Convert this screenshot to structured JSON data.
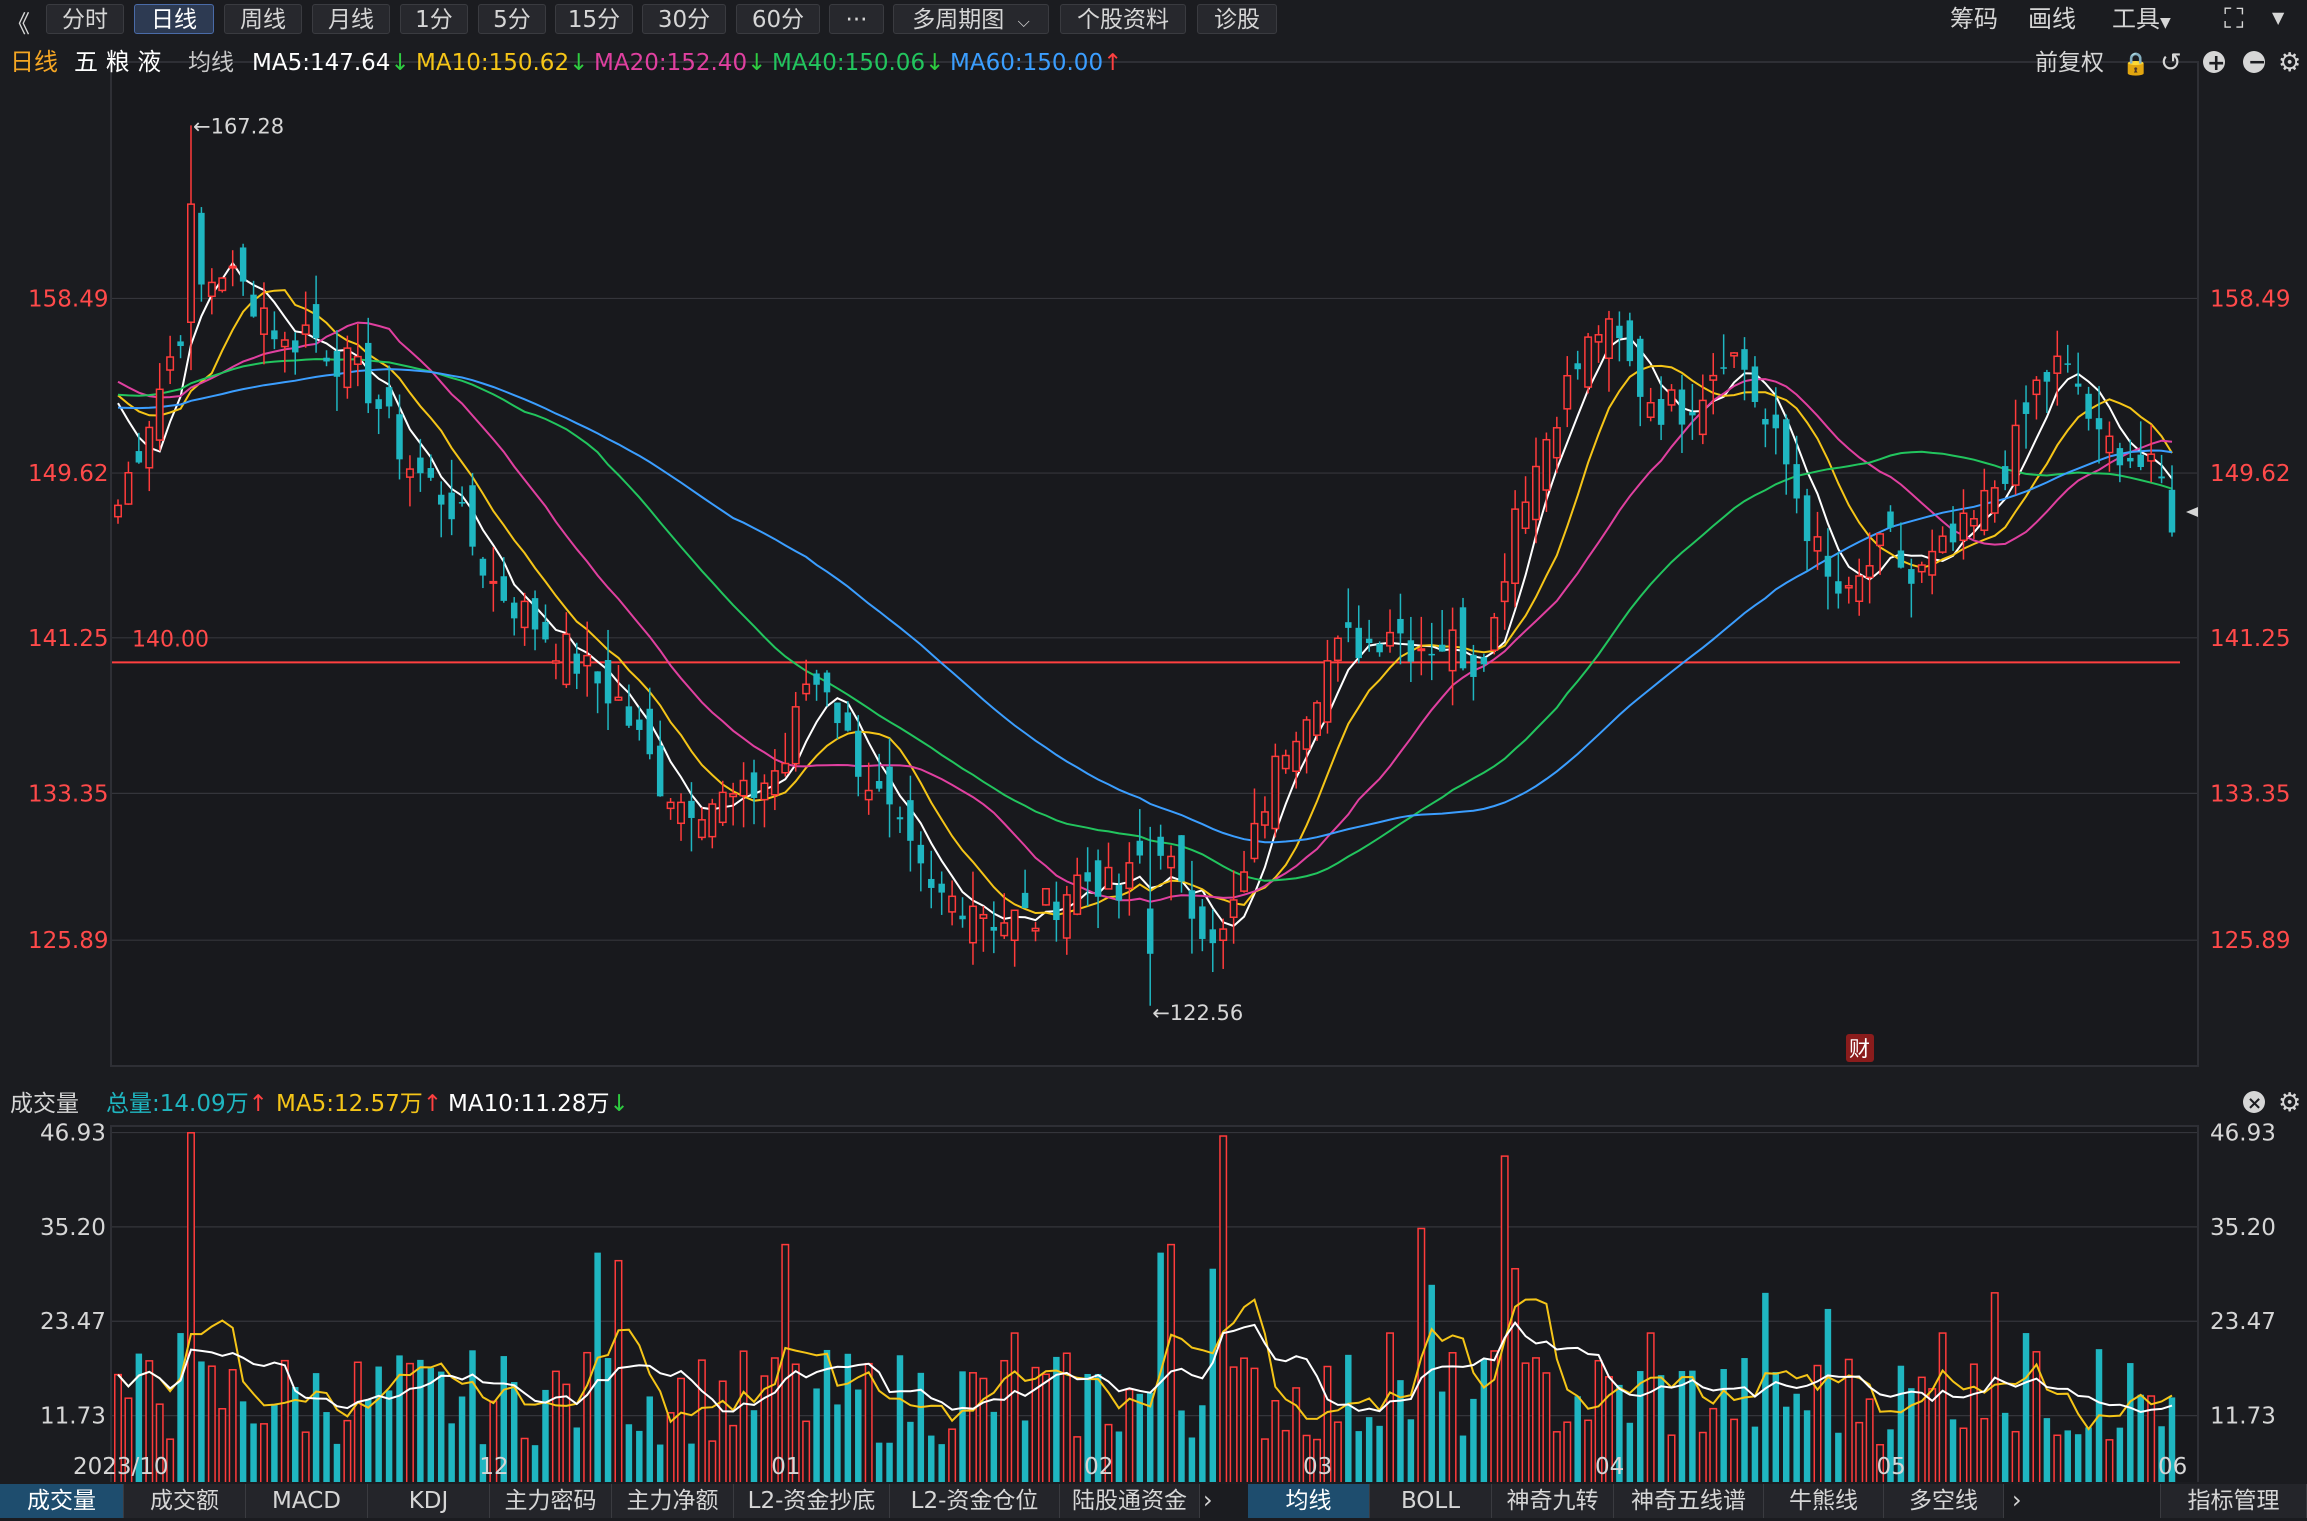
{
  "toolbar": {
    "back": "《",
    "tabs": [
      "分时",
      "日线",
      "周线",
      "月线",
      "1分",
      "5分",
      "15分",
      "30分",
      "60分"
    ],
    "active_tab": 1,
    "more": "···",
    "multi": "多周期图",
    "profile": "个股资料",
    "diag": "诊股",
    "right": [
      "筹码",
      "画线",
      "工具"
    ]
  },
  "header": {
    "period": "日线",
    "stock": "五 粮 液",
    "ma_label": "均线",
    "ma": [
      {
        "text": "MA5:147.64",
        "arrow": "↓",
        "color": "#ffffff",
        "arrow_color": "#2ecc40"
      },
      {
        "text": "MA10:150.62",
        "arrow": "↓",
        "color": "#f5c518",
        "arrow_color": "#2ecc40"
      },
      {
        "text": "MA20:152.40",
        "arrow": "↓",
        "color": "#e040a0",
        "arrow_color": "#2ecc40"
      },
      {
        "text": "MA40:150.06",
        "arrow": "↓",
        "color": "#22c55e",
        "arrow_color": "#2ecc40"
      },
      {
        "text": "MA60:150.00",
        "arrow": "↑",
        "color": "#3b9eff",
        "arrow_color": "#ff4040"
      }
    ],
    "adjust": "前复权"
  },
  "volume_header": {
    "title": "成交量",
    "total": "总量:14.09万",
    "total_arrow": "↑",
    "ma5": "MA5:12.57万",
    "ma5_arrow": "↑",
    "ma10": "MA10:11.28万",
    "ma10_arrow": "↓"
  },
  "bottom_tabs_left": [
    "成交量",
    "成交额",
    "MACD",
    "KDJ",
    "主力密码",
    "主力净额",
    "L2-资金抄底",
    "L2-资金仓位",
    "陆股通资金"
  ],
  "bottom_tabs_right": [
    "均线",
    "BOLL",
    "神奇九转",
    "神奇五线谱",
    "牛熊线",
    "多空线"
  ],
  "bottom_right": "指标管理",
  "chart_data": {
    "type": "candlestick",
    "price_axis_labels": [
      "158.49",
      "149.62",
      "141.25",
      "133.35",
      "125.89"
    ],
    "price_ticks": [
      158.49,
      149.62,
      141.25,
      133.35,
      125.89
    ],
    "price_range": [
      119.5,
      170.5
    ],
    "high_annotation": "←167.28",
    "high_value": 167.28,
    "low_annotation": "←122.56",
    "low_value": 122.56,
    "hline_label": "140.00",
    "hline_value": 140.0,
    "badge": "财",
    "volume_axis_labels": [
      "46.93",
      "35.20",
      "23.47",
      "11.73"
    ],
    "volume_ticks": [
      46.93,
      35.2,
      23.47,
      11.73
    ],
    "volume_unit": "万",
    "volume_range": [
      0,
      47
    ],
    "x_labels": [
      {
        "label": "2023/10",
        "index": 0
      },
      {
        "label": "12",
        "index": 36
      },
      {
        "label": "01",
        "index": 64
      },
      {
        "label": "02",
        "index": 94
      },
      {
        "label": "03",
        "index": 115
      },
      {
        "label": "04",
        "index": 143
      },
      {
        "label": "05",
        "index": 170
      },
      {
        "label": "06",
        "index": 197
      }
    ],
    "count": 198,
    "waypoints": [
      [
        0,
        148
      ],
      [
        2,
        151
      ],
      [
        4,
        154
      ],
      [
        6,
        157
      ],
      [
        7,
        163
      ],
      [
        8,
        159
      ],
      [
        10,
        160
      ],
      [
        12,
        159
      ],
      [
        14,
        158
      ],
      [
        16,
        156
      ],
      [
        18,
        157
      ],
      [
        20,
        156
      ],
      [
        22,
        155
      ],
      [
        24,
        154
      ],
      [
        26,
        152
      ],
      [
        28,
        150
      ],
      [
        30,
        149
      ],
      [
        32,
        148
      ],
      [
        34,
        146
      ],
      [
        36,
        144
      ],
      [
        38,
        143
      ],
      [
        40,
        142
      ],
      [
        42,
        141
      ],
      [
        44,
        140
      ],
      [
        46,
        139
      ],
      [
        48,
        138
      ],
      [
        50,
        136
      ],
      [
        52,
        134
      ],
      [
        54,
        133
      ],
      [
        56,
        133
      ],
      [
        58,
        133
      ],
      [
        60,
        133
      ],
      [
        62,
        134
      ],
      [
        64,
        135
      ],
      [
        66,
        139
      ],
      [
        68,
        139
      ],
      [
        70,
        136
      ],
      [
        72,
        134
      ],
      [
        74,
        132
      ],
      [
        76,
        130
      ],
      [
        78,
        128
      ],
      [
        80,
        128
      ],
      [
        82,
        128
      ],
      [
        84,
        127
      ],
      [
        86,
        127
      ],
      [
        88,
        127
      ],
      [
        90,
        128
      ],
      [
        92,
        129
      ],
      [
        94,
        129
      ],
      [
        96,
        128
      ],
      [
        98,
        130
      ],
      [
        100,
        131
      ],
      [
        102,
        128
      ],
      [
        104,
        127
      ],
      [
        106,
        126
      ],
      [
        108,
        129
      ],
      [
        110,
        133
      ],
      [
        112,
        136
      ],
      [
        114,
        138
      ],
      [
        116,
        140
      ],
      [
        118,
        141
      ],
      [
        120,
        141
      ],
      [
        122,
        142
      ],
      [
        124,
        141
      ],
      [
        126,
        141
      ],
      [
        128,
        141
      ],
      [
        130,
        140
      ],
      [
        132,
        142
      ],
      [
        134,
        148
      ],
      [
        136,
        150
      ],
      [
        138,
        153
      ],
      [
        140,
        155
      ],
      [
        142,
        157
      ],
      [
        144,
        156
      ],
      [
        146,
        154
      ],
      [
        148,
        153
      ],
      [
        150,
        153
      ],
      [
        152,
        154
      ],
      [
        154,
        156
      ],
      [
        156,
        155
      ],
      [
        158,
        152
      ],
      [
        160,
        150
      ],
      [
        162,
        147
      ],
      [
        164,
        144
      ],
      [
        166,
        143
      ],
      [
        168,
        145
      ],
      [
        170,
        146
      ],
      [
        172,
        144
      ],
      [
        174,
        145
      ],
      [
        176,
        146
      ],
      [
        178,
        147
      ],
      [
        180,
        149
      ],
      [
        182,
        151
      ],
      [
        184,
        154
      ],
      [
        186,
        155
      ],
      [
        188,
        154
      ],
      [
        190,
        151
      ],
      [
        192,
        151
      ],
      [
        194,
        150
      ],
      [
        196,
        149
      ],
      [
        197,
        148
      ]
    ],
    "ma_series": [
      {
        "name": "MA5",
        "color": "#ffffff",
        "period": 5
      },
      {
        "name": "MA10",
        "color": "#f5c518",
        "period": 10
      },
      {
        "name": "MA20",
        "color": "#e040a0",
        "period": 20
      },
      {
        "name": "MA40",
        "color": "#22c55e",
        "period": 40
      },
      {
        "name": "MA60",
        "color": "#3b9eff",
        "period": 60
      }
    ],
    "up_color": "#ff3b3b",
    "down_color": "#1fb6c1"
  }
}
